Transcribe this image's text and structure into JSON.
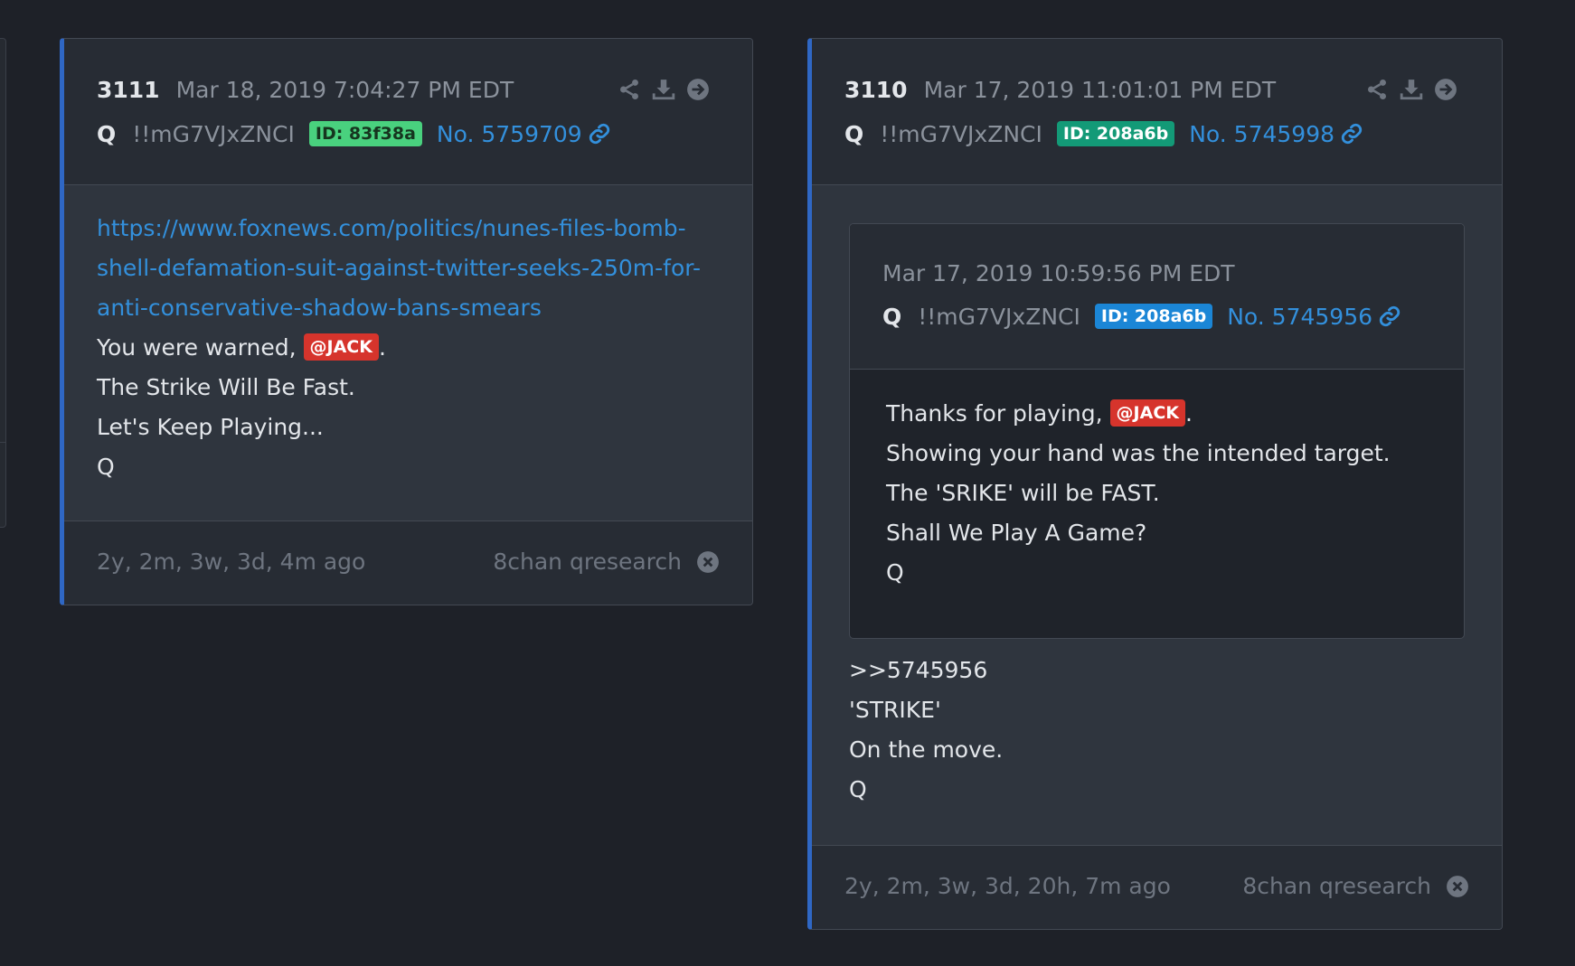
{
  "colors": {
    "page_bg": "#1e2128",
    "card_accent": "#2f67c4",
    "link": "#3390dc",
    "mention_bg": "#d6342c",
    "id_badge_green": "#49d17e",
    "id_badge_teal": "#139a77",
    "id_badge_blue": "#1b86d6"
  },
  "icons": {
    "toolbar": [
      "share-icon",
      "download-icon",
      "arrow-right-circle-icon"
    ],
    "post_link": "link-icon",
    "footer": "close-circle-icon"
  },
  "posts": [
    {
      "number": "3111",
      "date": "Mar 18, 2019 7:04:27 PM EDT",
      "author": "Q",
      "tripcode": "!!mG7VJxZNCI",
      "id_label": "ID: 83f38a",
      "post_no": "No. 5759709",
      "body": {
        "url_lines": [
          "https://www.foxnews.com/politics/nunes-files-bomb-",
          "shell-defamation-suit-against-twitter-seeks-250m-for-",
          "anti-conservative-shadow-bans-smears"
        ],
        "warned_prefix": "You were warned,",
        "mention": "@JACK",
        "warned_suffix": ".",
        "lines": [
          "The Strike Will Be Fast.",
          "Let's Keep Playing...",
          "Q"
        ]
      },
      "ago": "2y, 2m, 3w, 3d, 4m ago",
      "source": "8chan qresearch"
    },
    {
      "number": "3110",
      "date": "Mar 17, 2019 11:01:01 PM EDT",
      "author": "Q",
      "tripcode": "!!mG7VJxZNCI",
      "id_label": "ID: 208a6b",
      "post_no": "No. 5745998",
      "quote": {
        "date": "Mar 17, 2019 10:59:56 PM EDT",
        "author": "Q",
        "tripcode": "!!mG7VJxZNCI",
        "id_label": "ID: 208a6b",
        "post_no": "No. 5745956",
        "thanks_prefix": "Thanks for playing,",
        "mention": "@JACK",
        "thanks_suffix": ".",
        "lines": [
          "Showing your hand was the intended target.",
          "The 'SRIKE' will be FAST.",
          "Shall We Play A Game?",
          "Q"
        ]
      },
      "body_lines": [
        ">>5745956",
        "'STRIKE'",
        "On the move.",
        "Q"
      ],
      "ago": "2y, 2m, 3w, 3d, 20h, 7m ago",
      "source": "8chan qresearch"
    }
  ]
}
